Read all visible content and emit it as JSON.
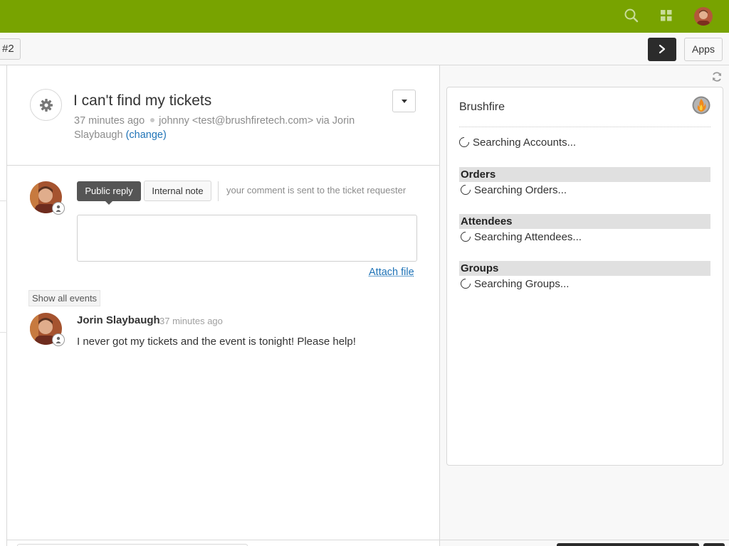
{
  "topbar": {
    "background": "#78a300",
    "search_icon": "search-icon",
    "apps_icon": "apps-grid-icon",
    "avatar_icon": "user-avatar"
  },
  "subbar": {
    "tab_label": "#2",
    "next_icon": "chevron-right-icon",
    "apps_button_label": "Apps"
  },
  "ticket": {
    "settings_icon": "gear-icon",
    "title": "I can't find my tickets",
    "time_ago": "37 minutes ago",
    "requester_via": "johnny <test@brushfiretech.com> via Jorin Slaybaugh",
    "change_label": "(change)",
    "dropdown_icon": "caret-down-icon"
  },
  "reply": {
    "public_reply_label": "Public reply",
    "internal_note_label": "Internal note",
    "hint": "your comment is sent to the ticket requester",
    "comment_value": "",
    "attach_file_label": "Attach file"
  },
  "events": {
    "show_all_label": "Show all events",
    "items": [
      {
        "author": "Jorin Slaybaugh",
        "time": "37 minutes ago",
        "body": "I never got my tickets and the event is tonight! Please help!"
      }
    ]
  },
  "app_panel": {
    "refresh_icon": "refresh-icon",
    "app_name": "Brushfire",
    "app_logo_icon": "brushfire-flame-logo",
    "searching_accounts": "Searching Accounts...",
    "sections": [
      {
        "heading": "Orders",
        "status": "Searching Orders..."
      },
      {
        "heading": "Attendees",
        "status": "Searching Attendees..."
      },
      {
        "heading": "Groups",
        "status": "Searching Groups..."
      }
    ]
  }
}
